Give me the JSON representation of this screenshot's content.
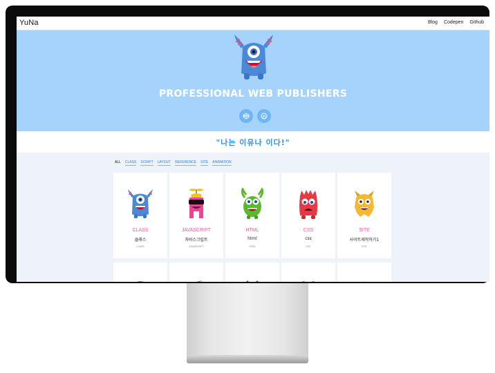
{
  "site": {
    "logo": "YuNa"
  },
  "nav": {
    "items": [
      "Blog",
      "Codepen",
      "Github"
    ]
  },
  "hero": {
    "title": "PROFESSIONAL WEB PUBLISHERS",
    "icons": [
      "codepen-icon",
      "github-icon"
    ],
    "bg": "#a5d3fb"
  },
  "quote": "\"나는 이유나 이다!\"",
  "filters": [
    "ALL",
    "CLASS",
    "SCRIPT",
    "LAYOUT",
    "REFERENCE",
    "SITE",
    "ANIMATION"
  ],
  "cards": [
    {
      "category": "CLASS",
      "title": "클래스",
      "sub": "CLASS",
      "monster": "blue-monster"
    },
    {
      "category": "JAVASCRIPT",
      "title": "자바스크립트",
      "sub": "JAVASCRIPT",
      "monster": "pink-monster"
    },
    {
      "category": "HTML",
      "title": "html",
      "sub": "HTML",
      "monster": "green-monster"
    },
    {
      "category": "CSS",
      "title": "css",
      "sub": "CSS",
      "monster": "red-monster"
    },
    {
      "category": "SITE",
      "title": "사이트제작하기1",
      "sub": "SITE",
      "monster": "yellow-monster"
    }
  ],
  "colors": {
    "accent": "#2e8fe3",
    "category": "#e75ca6",
    "monitor": "#0b0b0b"
  }
}
